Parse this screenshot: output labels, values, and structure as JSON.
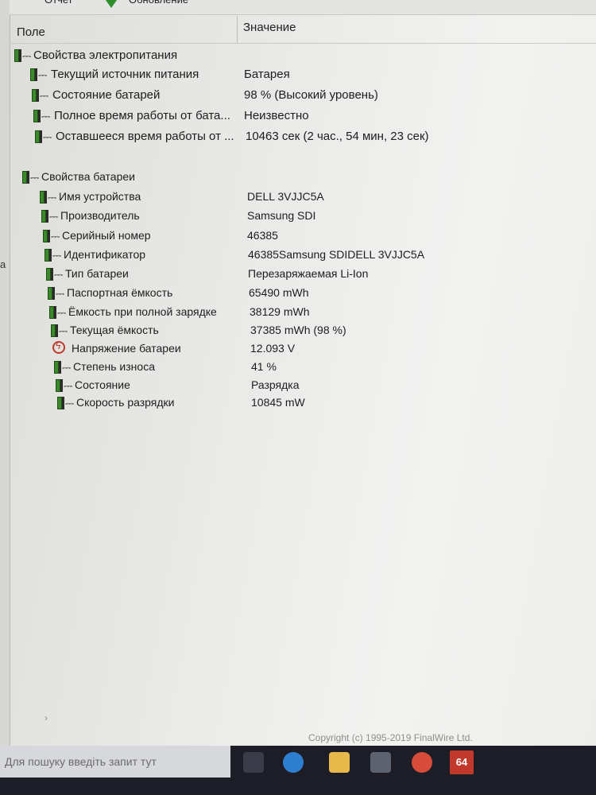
{
  "toolbar": {
    "report_label": "Отчет",
    "refresh_label": "Обновление"
  },
  "header": {
    "field": "Поле",
    "value": "Значение"
  },
  "groups": [
    {
      "title": "Свойства электропитания",
      "rows": [
        {
          "label": "Текущий источник питания",
          "value": "Батарея"
        },
        {
          "label": "Состояние батарей",
          "value": "98 % (Высокий уровень)"
        },
        {
          "label": "Полное время работы от бата...",
          "value": "Неизвестно"
        },
        {
          "label": "Оставшееся время работы от ...",
          "value": "10463 сек (2 час., 54 мин, 23 сек)"
        }
      ]
    },
    {
      "title": "Свойства батареи",
      "rows": [
        {
          "label": "Имя устройства",
          "value": "DELL 3VJJC5A"
        },
        {
          "label": "Производитель",
          "value": "Samsung SDI"
        },
        {
          "label": "Серийный номер",
          "value": "46385"
        },
        {
          "label": "Идентификатор",
          "value": "46385Samsung SDIDELL 3VJJC5A"
        },
        {
          "label": "Тип батареи",
          "value": "Перезаряжаемая Li-Ion"
        },
        {
          "label": "Паспортная ёмкость",
          "value": "65490 mWh"
        },
        {
          "label": "Ёмкость при полной зарядке",
          "value": "38129 mWh"
        },
        {
          "label": "Текущая ёмкость",
          "value": "37385 mWh  (98 %)"
        },
        {
          "label": "Напряжение батареи",
          "value": "12.093 V",
          "icon": "voltage-icon"
        },
        {
          "label": "Степень износа",
          "value": "41 %"
        },
        {
          "label": "Состояние",
          "value": "Разрядка"
        },
        {
          "label": "Скорость разрядки",
          "value": "10845 mW"
        }
      ]
    }
  ],
  "left_pane": {
    "fragment": "а"
  },
  "copyright": "Copyright (c) 1995-2019 FinalWire Ltd.",
  "taskbar": {
    "search_placeholder": "Для пошуку введіть запит тут",
    "aida_label": "64"
  },
  "colors": {
    "battery_green": "#3a8a2c",
    "voltage_red": "#c0392b",
    "taskbar": "#1c1d27"
  }
}
